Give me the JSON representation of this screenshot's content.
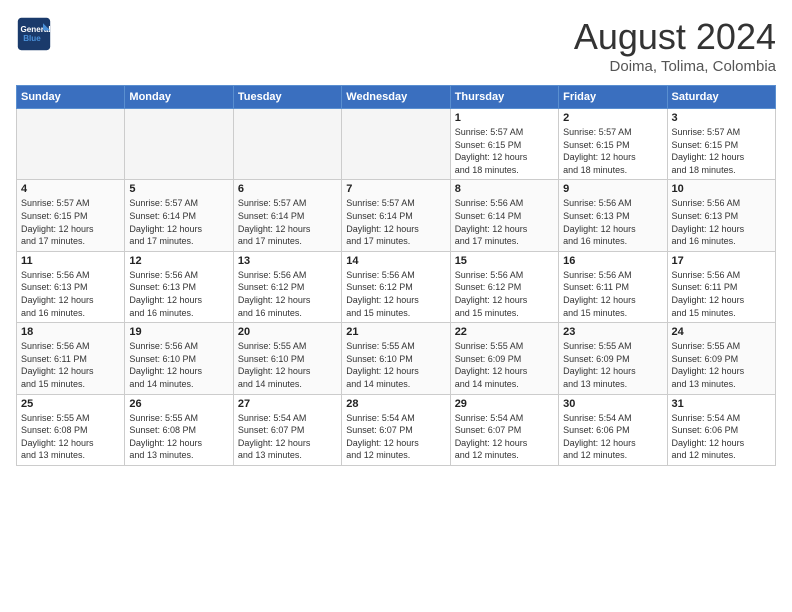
{
  "header": {
    "logo_line1": "General",
    "logo_line2": "Blue",
    "month_year": "August 2024",
    "location": "Doima, Tolima, Colombia"
  },
  "weekdays": [
    "Sunday",
    "Monday",
    "Tuesday",
    "Wednesday",
    "Thursday",
    "Friday",
    "Saturday"
  ],
  "weeks": [
    [
      {
        "day": "",
        "info": ""
      },
      {
        "day": "",
        "info": ""
      },
      {
        "day": "",
        "info": ""
      },
      {
        "day": "",
        "info": ""
      },
      {
        "day": "1",
        "info": "Sunrise: 5:57 AM\nSunset: 6:15 PM\nDaylight: 12 hours\nand 18 minutes."
      },
      {
        "day": "2",
        "info": "Sunrise: 5:57 AM\nSunset: 6:15 PM\nDaylight: 12 hours\nand 18 minutes."
      },
      {
        "day": "3",
        "info": "Sunrise: 5:57 AM\nSunset: 6:15 PM\nDaylight: 12 hours\nand 18 minutes."
      }
    ],
    [
      {
        "day": "4",
        "info": "Sunrise: 5:57 AM\nSunset: 6:15 PM\nDaylight: 12 hours\nand 17 minutes."
      },
      {
        "day": "5",
        "info": "Sunrise: 5:57 AM\nSunset: 6:14 PM\nDaylight: 12 hours\nand 17 minutes."
      },
      {
        "day": "6",
        "info": "Sunrise: 5:57 AM\nSunset: 6:14 PM\nDaylight: 12 hours\nand 17 minutes."
      },
      {
        "day": "7",
        "info": "Sunrise: 5:57 AM\nSunset: 6:14 PM\nDaylight: 12 hours\nand 17 minutes."
      },
      {
        "day": "8",
        "info": "Sunrise: 5:56 AM\nSunset: 6:14 PM\nDaylight: 12 hours\nand 17 minutes."
      },
      {
        "day": "9",
        "info": "Sunrise: 5:56 AM\nSunset: 6:13 PM\nDaylight: 12 hours\nand 16 minutes."
      },
      {
        "day": "10",
        "info": "Sunrise: 5:56 AM\nSunset: 6:13 PM\nDaylight: 12 hours\nand 16 minutes."
      }
    ],
    [
      {
        "day": "11",
        "info": "Sunrise: 5:56 AM\nSunset: 6:13 PM\nDaylight: 12 hours\nand 16 minutes."
      },
      {
        "day": "12",
        "info": "Sunrise: 5:56 AM\nSunset: 6:13 PM\nDaylight: 12 hours\nand 16 minutes."
      },
      {
        "day": "13",
        "info": "Sunrise: 5:56 AM\nSunset: 6:12 PM\nDaylight: 12 hours\nand 16 minutes."
      },
      {
        "day": "14",
        "info": "Sunrise: 5:56 AM\nSunset: 6:12 PM\nDaylight: 12 hours\nand 15 minutes."
      },
      {
        "day": "15",
        "info": "Sunrise: 5:56 AM\nSunset: 6:12 PM\nDaylight: 12 hours\nand 15 minutes."
      },
      {
        "day": "16",
        "info": "Sunrise: 5:56 AM\nSunset: 6:11 PM\nDaylight: 12 hours\nand 15 minutes."
      },
      {
        "day": "17",
        "info": "Sunrise: 5:56 AM\nSunset: 6:11 PM\nDaylight: 12 hours\nand 15 minutes."
      }
    ],
    [
      {
        "day": "18",
        "info": "Sunrise: 5:56 AM\nSunset: 6:11 PM\nDaylight: 12 hours\nand 15 minutes."
      },
      {
        "day": "19",
        "info": "Sunrise: 5:56 AM\nSunset: 6:10 PM\nDaylight: 12 hours\nand 14 minutes."
      },
      {
        "day": "20",
        "info": "Sunrise: 5:55 AM\nSunset: 6:10 PM\nDaylight: 12 hours\nand 14 minutes."
      },
      {
        "day": "21",
        "info": "Sunrise: 5:55 AM\nSunset: 6:10 PM\nDaylight: 12 hours\nand 14 minutes."
      },
      {
        "day": "22",
        "info": "Sunrise: 5:55 AM\nSunset: 6:09 PM\nDaylight: 12 hours\nand 14 minutes."
      },
      {
        "day": "23",
        "info": "Sunrise: 5:55 AM\nSunset: 6:09 PM\nDaylight: 12 hours\nand 13 minutes."
      },
      {
        "day": "24",
        "info": "Sunrise: 5:55 AM\nSunset: 6:09 PM\nDaylight: 12 hours\nand 13 minutes."
      }
    ],
    [
      {
        "day": "25",
        "info": "Sunrise: 5:55 AM\nSunset: 6:08 PM\nDaylight: 12 hours\nand 13 minutes."
      },
      {
        "day": "26",
        "info": "Sunrise: 5:55 AM\nSunset: 6:08 PM\nDaylight: 12 hours\nand 13 minutes."
      },
      {
        "day": "27",
        "info": "Sunrise: 5:54 AM\nSunset: 6:07 PM\nDaylight: 12 hours\nand 13 minutes."
      },
      {
        "day": "28",
        "info": "Sunrise: 5:54 AM\nSunset: 6:07 PM\nDaylight: 12 hours\nand 12 minutes."
      },
      {
        "day": "29",
        "info": "Sunrise: 5:54 AM\nSunset: 6:07 PM\nDaylight: 12 hours\nand 12 minutes."
      },
      {
        "day": "30",
        "info": "Sunrise: 5:54 AM\nSunset: 6:06 PM\nDaylight: 12 hours\nand 12 minutes."
      },
      {
        "day": "31",
        "info": "Sunrise: 5:54 AM\nSunset: 6:06 PM\nDaylight: 12 hours\nand 12 minutes."
      }
    ]
  ]
}
